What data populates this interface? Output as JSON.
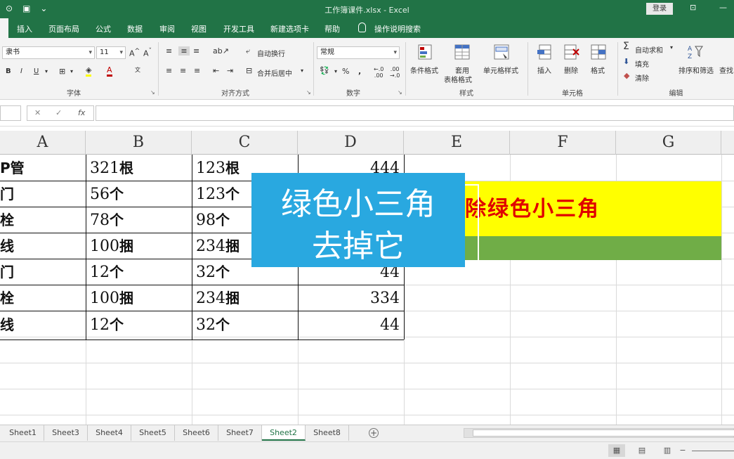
{
  "titlebar": {
    "title": "工作簿课件.xlsx  -  Excel",
    "login": "登录"
  },
  "tabs": [
    "插入",
    "页面布局",
    "公式",
    "数据",
    "审阅",
    "视图",
    "开发工具",
    "新建选项卡",
    "帮助",
    "操作说明搜索"
  ],
  "ribbon": {
    "font_name": "隶书",
    "font_size": "11",
    "wrap_text": "自动换行",
    "merge_center": "合并后居中",
    "number_format": "常规",
    "cond_format": "条件格式",
    "table_format_1": "套用",
    "table_format_2": "表格格式",
    "cell_style": "单元格样式",
    "insert": "插入",
    "delete": "删除",
    "format": "格式",
    "autosum": "自动求和",
    "fill": "填充",
    "clear": "清除",
    "sort_filter": "排序和筛选",
    "find": "查找",
    "grp_font": "字体",
    "grp_align": "对齐方式",
    "grp_number": "数字",
    "grp_style": "样式",
    "grp_cells": "单元格",
    "grp_edit": "编辑",
    "bold": "B",
    "italic": "I",
    "underline": "U",
    "percent": "%",
    "comma": ","
  },
  "formula_bar": {
    "fx": "fx"
  },
  "columns": [
    "A",
    "B",
    "C",
    "D",
    "E",
    "F",
    "G"
  ],
  "rows": [
    {
      "a": "P管",
      "b_num": "321",
      "b_unit": "根",
      "c_num": "123",
      "c_unit": "根",
      "d": "444"
    },
    {
      "a": "门",
      "b_num": "56",
      "b_unit": "个",
      "c_num": "123",
      "c_unit": "个",
      "d": ""
    },
    {
      "a": "栓",
      "b_num": "78",
      "b_unit": "个",
      "c_num": "98",
      "c_unit": "个",
      "d": ""
    },
    {
      "a": "线",
      "b_num": "100",
      "b_unit": "捆",
      "c_num": "234",
      "c_unit": "捆",
      "d": ""
    },
    {
      "a": "门",
      "b_num": "12",
      "b_unit": "个",
      "c_num": "32",
      "c_unit": "个",
      "d": "44"
    },
    {
      "a": "栓",
      "b_num": "100",
      "b_unit": "捆",
      "c_num": "234",
      "c_unit": "捆",
      "d": "334"
    },
    {
      "a": "线",
      "b_num": "12",
      "b_unit": "个",
      "c_num": "32",
      "c_unit": "个",
      "d": "44"
    }
  ],
  "banner": {
    "text": "除绿色小三角"
  },
  "overlay": {
    "line1": "绿色小三角",
    "line2": "去掉它"
  },
  "sheets": [
    "Sheet1",
    "Sheet3",
    "Sheet4",
    "Sheet5",
    "Sheet6",
    "Sheet7",
    "Sheet2",
    "Sheet8"
  ],
  "active_sheet": "Sheet2",
  "colors": {
    "excel_green": "#217346",
    "banner_yellow": "#ffff00",
    "banner_text_red": "#e00000",
    "green_bar": "#70ad47",
    "overlay_blue": "#29a8e0"
  }
}
